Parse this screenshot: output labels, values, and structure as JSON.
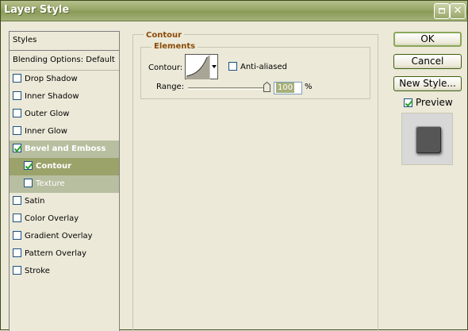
{
  "window": {
    "title": "Layer Style"
  },
  "styles_list": {
    "header": "Styles",
    "blending_options": "Blending Options: Default",
    "items": [
      {
        "label": "Drop Shadow",
        "checked": false
      },
      {
        "label": "Inner Shadow",
        "checked": false
      },
      {
        "label": "Outer Glow",
        "checked": false
      },
      {
        "label": "Inner Glow",
        "checked": false
      },
      {
        "label": "Bevel and Emboss",
        "checked": true
      },
      {
        "label": "Contour",
        "checked": true
      },
      {
        "label": "Texture",
        "checked": false
      },
      {
        "label": "Satin",
        "checked": false
      },
      {
        "label": "Color Overlay",
        "checked": false
      },
      {
        "label": "Gradient Overlay",
        "checked": false
      },
      {
        "label": "Pattern Overlay",
        "checked": false
      },
      {
        "label": "Stroke",
        "checked": false
      }
    ]
  },
  "contour_panel": {
    "section_title": "Contour",
    "group_title": "Elements",
    "contour_label": "Contour:",
    "anti_aliased_label": "Anti-aliased",
    "anti_aliased_checked": false,
    "range_label": "Range:",
    "range_value": "100",
    "range_unit": "%",
    "range_percent": 100
  },
  "buttons": {
    "ok": "OK",
    "cancel": "Cancel",
    "new_style": "New Style..."
  },
  "preview": {
    "label": "Preview",
    "checked": true
  },
  "colors": {
    "selected_item_bg": "#9ba36b",
    "parent_item_bg": "#b8bfa0",
    "section_title": "#8a4b08",
    "titlebar": "#95a565"
  }
}
